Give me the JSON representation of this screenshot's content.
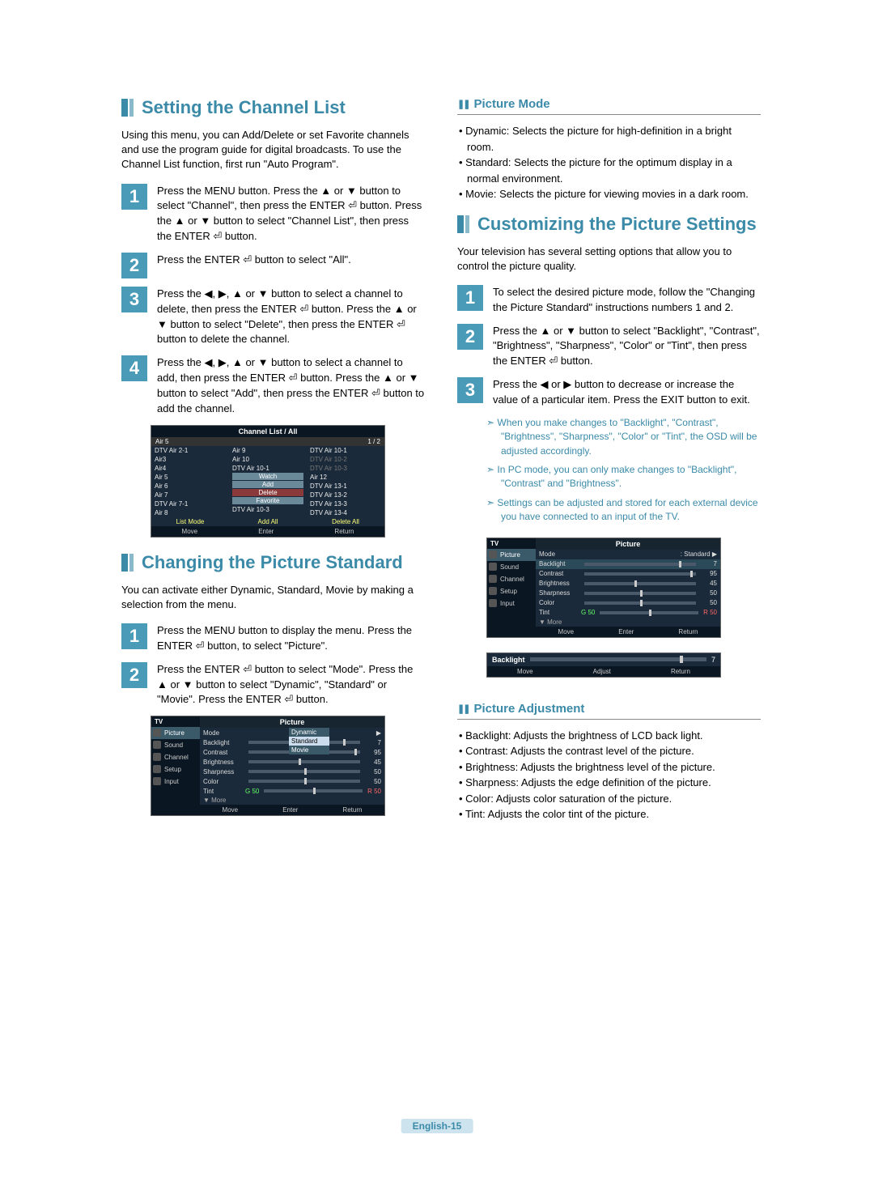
{
  "left": {
    "setting_channel": {
      "title": "Setting the Channel List",
      "intro": "Using this menu, you can Add/Delete or set Favorite channels and use the program guide for digital broadcasts. To use the Channel List function, first run \"Auto Program\".",
      "steps": {
        "s1": "Press the MENU button. Press the ▲ or ▼ button to select \"Channel\", then press the ENTER ⏎ button. Press the ▲ or ▼ button to select \"Channel List\", then press the ENTER ⏎ button.",
        "s2": "Press the ENTER ⏎ button to select \"All\".",
        "s3": "Press the ◀, ▶, ▲ or ▼ button to select a channel to delete, then press the ENTER ⏎ button. Press the ▲ or ▼ button to select \"Delete\", then press the ENTER ⏎ button to delete the channel.",
        "s4": "Press the ◀, ▶, ▲ or ▼ button to select a channel to add, then press the ENTER ⏎ button. Press the ▲ or ▼ button to select \"Add\", then press the ENTER ⏎ button to add the channel."
      }
    },
    "changing_picture": {
      "title": "Changing the Picture Standard",
      "intro": "You can activate either Dynamic, Standard, Movie by making a selection from the menu.",
      "steps": {
        "s1": "Press the MENU button to display the menu. Press the ENTER ⏎ button, to select \"Picture\".",
        "s2": "Press the ENTER ⏎ button to select \"Mode\". Press the ▲ or ▼ button to select \"Dynamic\", \"Standard\" or \"Movie\". Press the ENTER ⏎ button."
      }
    },
    "osd_chlist": {
      "title": "Channel List / All",
      "hdr_left": "Air 5",
      "hdr_right": "1 / 2",
      "col1": [
        "DTV Air 2-1",
        "Air3",
        "Air4",
        "Air 5",
        "Air 6",
        "Air 7",
        "DTV Air 7-1",
        "Air 8"
      ],
      "col2_top": [
        "Air 9",
        "Air 10",
        "DTV Air 10-1"
      ],
      "col2_btns": [
        "Watch",
        "Add",
        "Delete",
        "Favorite"
      ],
      "col2_bottom": "DTV Air 10-3",
      "col3": [
        "DTV Air 10-1",
        "DTV Air 10-2",
        "DTV Air 10-3",
        "Air 12",
        "DTV Air 13-1",
        "DTV Air 13-2",
        "DTV Air 13-3",
        "DTV Air 13-4"
      ],
      "foot": [
        "List Mode",
        "Add All",
        "Delete All"
      ],
      "bar": [
        "Move",
        "Enter",
        "Return"
      ]
    },
    "osd_picture1": {
      "side_hdr": "TV",
      "side": [
        "Picture",
        "Sound",
        "Channel",
        "Setup",
        "Input"
      ],
      "title": "Picture",
      "mode_lbl": "Mode",
      "dropdown": [
        "Dynamic",
        "Standard",
        "Movie"
      ],
      "rows": [
        {
          "lbl": "Backlight",
          "val": "7",
          "thumb": 85
        },
        {
          "lbl": "Contrast",
          "val": "95",
          "thumb": 95
        },
        {
          "lbl": "Brightness",
          "val": "45",
          "thumb": 45
        },
        {
          "lbl": "Sharpness",
          "val": "50",
          "thumb": 50
        },
        {
          "lbl": "Color",
          "val": "50",
          "thumb": 50
        }
      ],
      "tint_lbl": "Tint",
      "tint_g": "G 50",
      "tint_r": "R 50",
      "more": "▼ More",
      "bar": [
        "Move",
        "Enter",
        "Return"
      ]
    }
  },
  "right": {
    "picture_mode": {
      "title": "Picture Mode",
      "items": {
        "dynamic": "Dynamic: Selects the picture for high-definition in a bright room.",
        "standard": "Standard: Selects the picture for the optimum display in a normal environment.",
        "movie": "Movie: Selects the picture for viewing movies in a dark room."
      }
    },
    "custom": {
      "title": "Customizing the Picture Settings",
      "intro": "Your television has several setting options that allow you to control the picture quality.",
      "steps": {
        "s1": "To select the desired picture mode, follow the \"Changing the Picture Standard\" instructions numbers 1 and 2.",
        "s2": "Press the ▲ or ▼ button to select \"Backlight\", \"Contrast\", \"Brightness\", \"Sharpness\", \"Color\" or \"Tint\", then press the ENTER ⏎ button.",
        "s3": "Press the ◀ or ▶ button to decrease or increase the value of a particular item. Press the EXIT button to exit."
      },
      "notes": {
        "n1": "When you make changes to \"Backlight\", \"Contrast\", \"Brightness\", \"Sharpness\", \"Color\" or \"Tint\", the OSD will be adjusted accordingly.",
        "n2": "In PC mode, you can only make changes to \"Backlight\", \"Contrast\" and \"Brightness\".",
        "n3": "Settings can be adjusted and stored for each external device you have connected to an input of the TV."
      }
    },
    "osd_picture2": {
      "side_hdr": "TV",
      "side": [
        "Picture",
        "Sound",
        "Channel",
        "Setup",
        "Input"
      ],
      "title": "Picture",
      "mode_lbl": "Mode",
      "mode_val": ": Standard",
      "rows": [
        {
          "lbl": "Backlight",
          "val": "7",
          "thumb": 85
        },
        {
          "lbl": "Contrast",
          "val": "95",
          "thumb": 95
        },
        {
          "lbl": "Brightness",
          "val": "45",
          "thumb": 45
        },
        {
          "lbl": "Sharpness",
          "val": "50",
          "thumb": 50
        },
        {
          "lbl": "Color",
          "val": "50",
          "thumb": 50
        }
      ],
      "tint_lbl": "Tint",
      "tint_g": "G 50",
      "tint_r": "R 50",
      "more": "▼ More",
      "bar": [
        "Move",
        "Enter",
        "Return"
      ]
    },
    "osd_backlight": {
      "lbl": "Backlight",
      "val": "7",
      "bar": [
        "Move",
        "Adjust",
        "Return"
      ]
    },
    "adjustment": {
      "title": "Picture Adjustment",
      "items": {
        "backlight": "Backlight: Adjusts the brightness of LCD back light.",
        "contrast": "Contrast: Adjusts the contrast level of the picture.",
        "brightness": "Brightness: Adjusts the brightness level of the picture.",
        "sharpness": "Sharpness: Adjusts the edge definition of the picture.",
        "color": "Color: Adjusts color saturation of the picture.",
        "tint": "Tint: Adjusts the color tint of the picture."
      }
    }
  },
  "page_num": "English-15"
}
